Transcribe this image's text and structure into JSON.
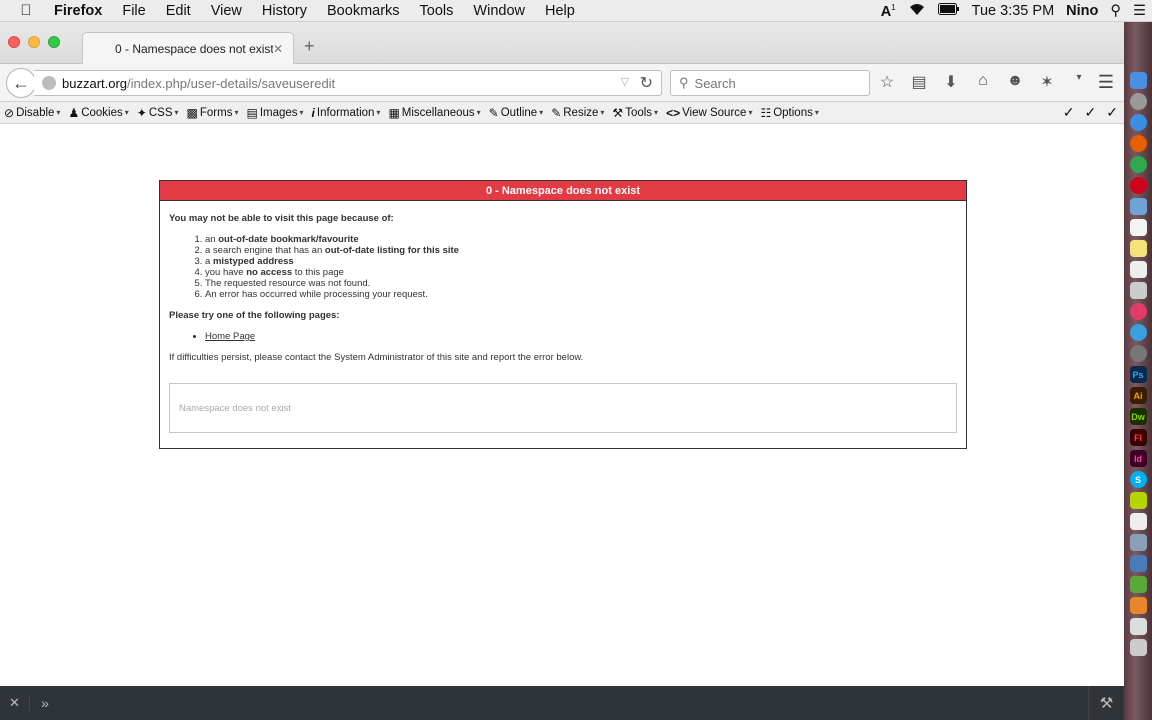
{
  "menubar": {
    "app_name": "Firefox",
    "items": [
      "File",
      "Edit",
      "View",
      "History",
      "Bookmarks",
      "Tools",
      "Window",
      "Help"
    ],
    "clock": "Tue 3:35 PM",
    "user": "Nino",
    "input_indicator": "1"
  },
  "tab": {
    "title": "0 - Namespace does not exist"
  },
  "navbar": {
    "url_host": "buzzart.org",
    "url_path": "/index.php/user-details/saveuseredit",
    "search_placeholder": "Search"
  },
  "devbar": {
    "items": [
      {
        "label": "Disable",
        "icon": "no-entry-icon"
      },
      {
        "label": "Cookies",
        "icon": "person-icon"
      },
      {
        "label": "CSS",
        "icon": "wand-icon"
      },
      {
        "label": "Forms",
        "icon": "clipboard-icon"
      },
      {
        "label": "Images",
        "icon": "image-icon"
      },
      {
        "label": "Information",
        "icon": "info-icon"
      },
      {
        "label": "Miscellaneous",
        "icon": "box-icon"
      },
      {
        "label": "Outline",
        "icon": "pencil-icon"
      },
      {
        "label": "Resize",
        "icon": "pencil-icon"
      },
      {
        "label": "Tools",
        "icon": "wrench-icon"
      },
      {
        "label": "View Source",
        "icon": "code-icon"
      },
      {
        "label": "Options",
        "icon": "options-icon"
      }
    ]
  },
  "page": {
    "header": "0 - Namespace does not exist",
    "intro": "You may not be able to visit this page because of:",
    "reasons": [
      {
        "pre": "an ",
        "bold": "out-of-date bookmark/favourite",
        "post": ""
      },
      {
        "pre": "a search engine that has an ",
        "bold": "out-of-date listing for this site",
        "post": ""
      },
      {
        "pre": "a ",
        "bold": "mistyped address",
        "post": ""
      },
      {
        "pre": "you have ",
        "bold": "no access",
        "post": " to this page"
      },
      {
        "pre": "The requested resource was not found.",
        "bold": "",
        "post": ""
      },
      {
        "pre": "An error has occurred while processing your request.",
        "bold": "",
        "post": ""
      }
    ],
    "try_heading": "Please try one of the following pages:",
    "home_link": "Home Page",
    "contact": "If difficulties persist, please contact the System Administrator of this site and report the error below.",
    "error_message": "Namespace does not exist"
  },
  "colors": {
    "header_red": "#e23b43",
    "bottombar": "#2f3438"
  }
}
